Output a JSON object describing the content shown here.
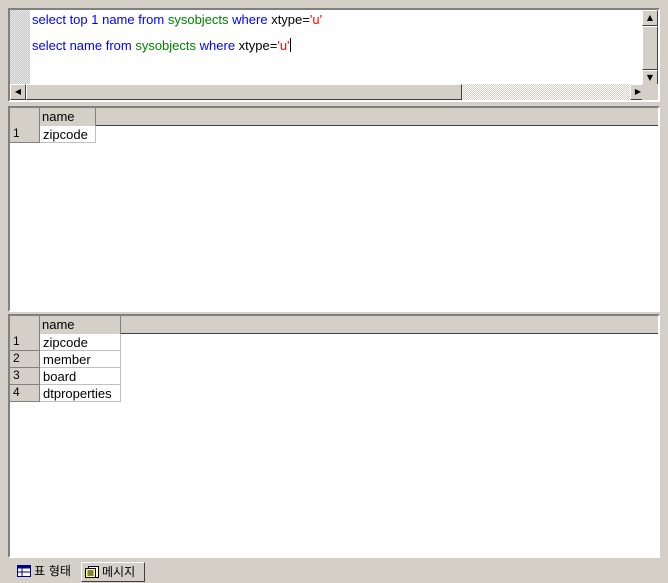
{
  "editor": {
    "line1": {
      "kw1": "select top 1 name from ",
      "obj": "sysobjects",
      "kw2": " where ",
      "col": "xtype",
      "eq": "=",
      "str": "'u'"
    },
    "line2": {
      "kw1": "select name from ",
      "obj": "sysobjects",
      "kw2": " where ",
      "col": "xtype",
      "eq": "=",
      "str": "'u'"
    }
  },
  "result1": {
    "column": "name",
    "rows": [
      {
        "num": "1",
        "value": "zipcode"
      }
    ]
  },
  "result2": {
    "column": "name",
    "rows": [
      {
        "num": "1",
        "value": "zipcode"
      },
      {
        "num": "2",
        "value": "member"
      },
      {
        "num": "3",
        "value": "board"
      },
      {
        "num": "4",
        "value": "dtproperties"
      }
    ]
  },
  "tabs": {
    "grids": "표 형태",
    "messages": "메시지"
  },
  "icons": {
    "grids_tab": "table-icon",
    "messages_tab": "document-icon",
    "scroll_up": "arrow-up-icon",
    "scroll_down": "arrow-down-icon",
    "scroll_left": "arrow-left-icon",
    "scroll_right": "arrow-right-icon"
  },
  "colors": {
    "keyword": "#0000ff",
    "object": "#008000",
    "string": "#ff0000",
    "chrome": "#d4d0c8"
  }
}
